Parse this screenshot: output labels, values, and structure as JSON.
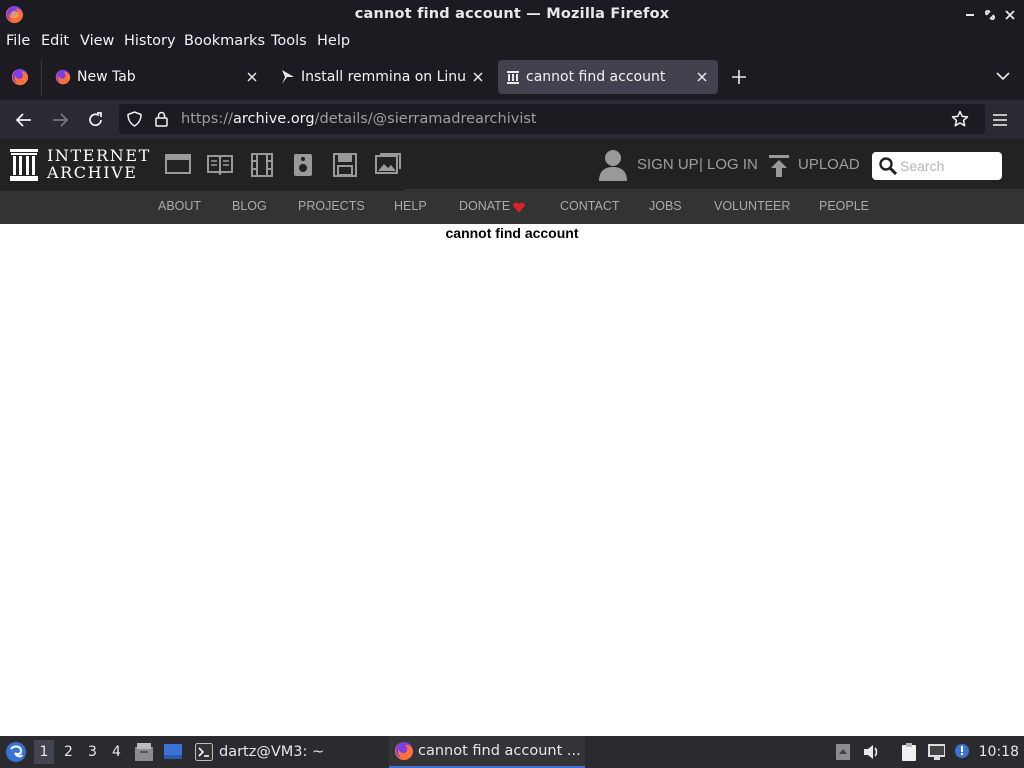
{
  "window": {
    "title": "cannot find account — Mozilla Firefox"
  },
  "menu": [
    "File",
    "Edit",
    "View",
    "History",
    "Bookmarks",
    "Tools",
    "Help"
  ],
  "menu_accel": [
    "F",
    "E",
    "V",
    "S",
    "B",
    "T",
    "H"
  ],
  "tabs": [
    {
      "label": "New Tab",
      "icon": "firefox-icon"
    },
    {
      "label": "Install remmina on Linux",
      "icon": "snapcraft-icon"
    },
    {
      "label": "cannot find account",
      "icon": "archive-icon",
      "selected": true
    }
  ],
  "address_bar": {
    "scheme": "https://",
    "host": "archive.org",
    "path": "/details/@sierramadrearchivist"
  },
  "ia": {
    "logo_line1": "INTERNET",
    "logo_line2": "ARCHIVE",
    "media_icons": [
      "web-icon",
      "texts-icon",
      "video-icon",
      "audio-icon",
      "software-icon",
      "images-icon"
    ],
    "signup": "SIGN UP",
    "divider": "|",
    "login": "LOG IN",
    "upload": "UPLOAD",
    "search_placeholder": "Search",
    "subnav": [
      "ABOUT",
      "BLOG",
      "PROJECTS",
      "HELP",
      "DONATE",
      "CONTACT",
      "JOBS",
      "VOLUNTEER",
      "PEOPLE"
    ],
    "donate_heart_color": "#e0202a"
  },
  "page": {
    "message": "cannot find account"
  },
  "taskbar": {
    "workspaces": [
      "1",
      "2",
      "3",
      "4"
    ],
    "active_workspace": "1",
    "tasks": [
      {
        "label": "dartz@VM3: ~",
        "icon": "terminal-icon"
      },
      {
        "label": "cannot find account ...",
        "icon": "firefox-icon",
        "active": true
      }
    ],
    "clock": "10:18"
  },
  "colors": {
    "firefox_chrome": "#1c1b22",
    "toolbar": "#2b2a33",
    "selected_tab": "#42414d",
    "ia_header": "#222222",
    "ia_subnav": "#333333",
    "taskbar_accent": "#3b73d4"
  }
}
